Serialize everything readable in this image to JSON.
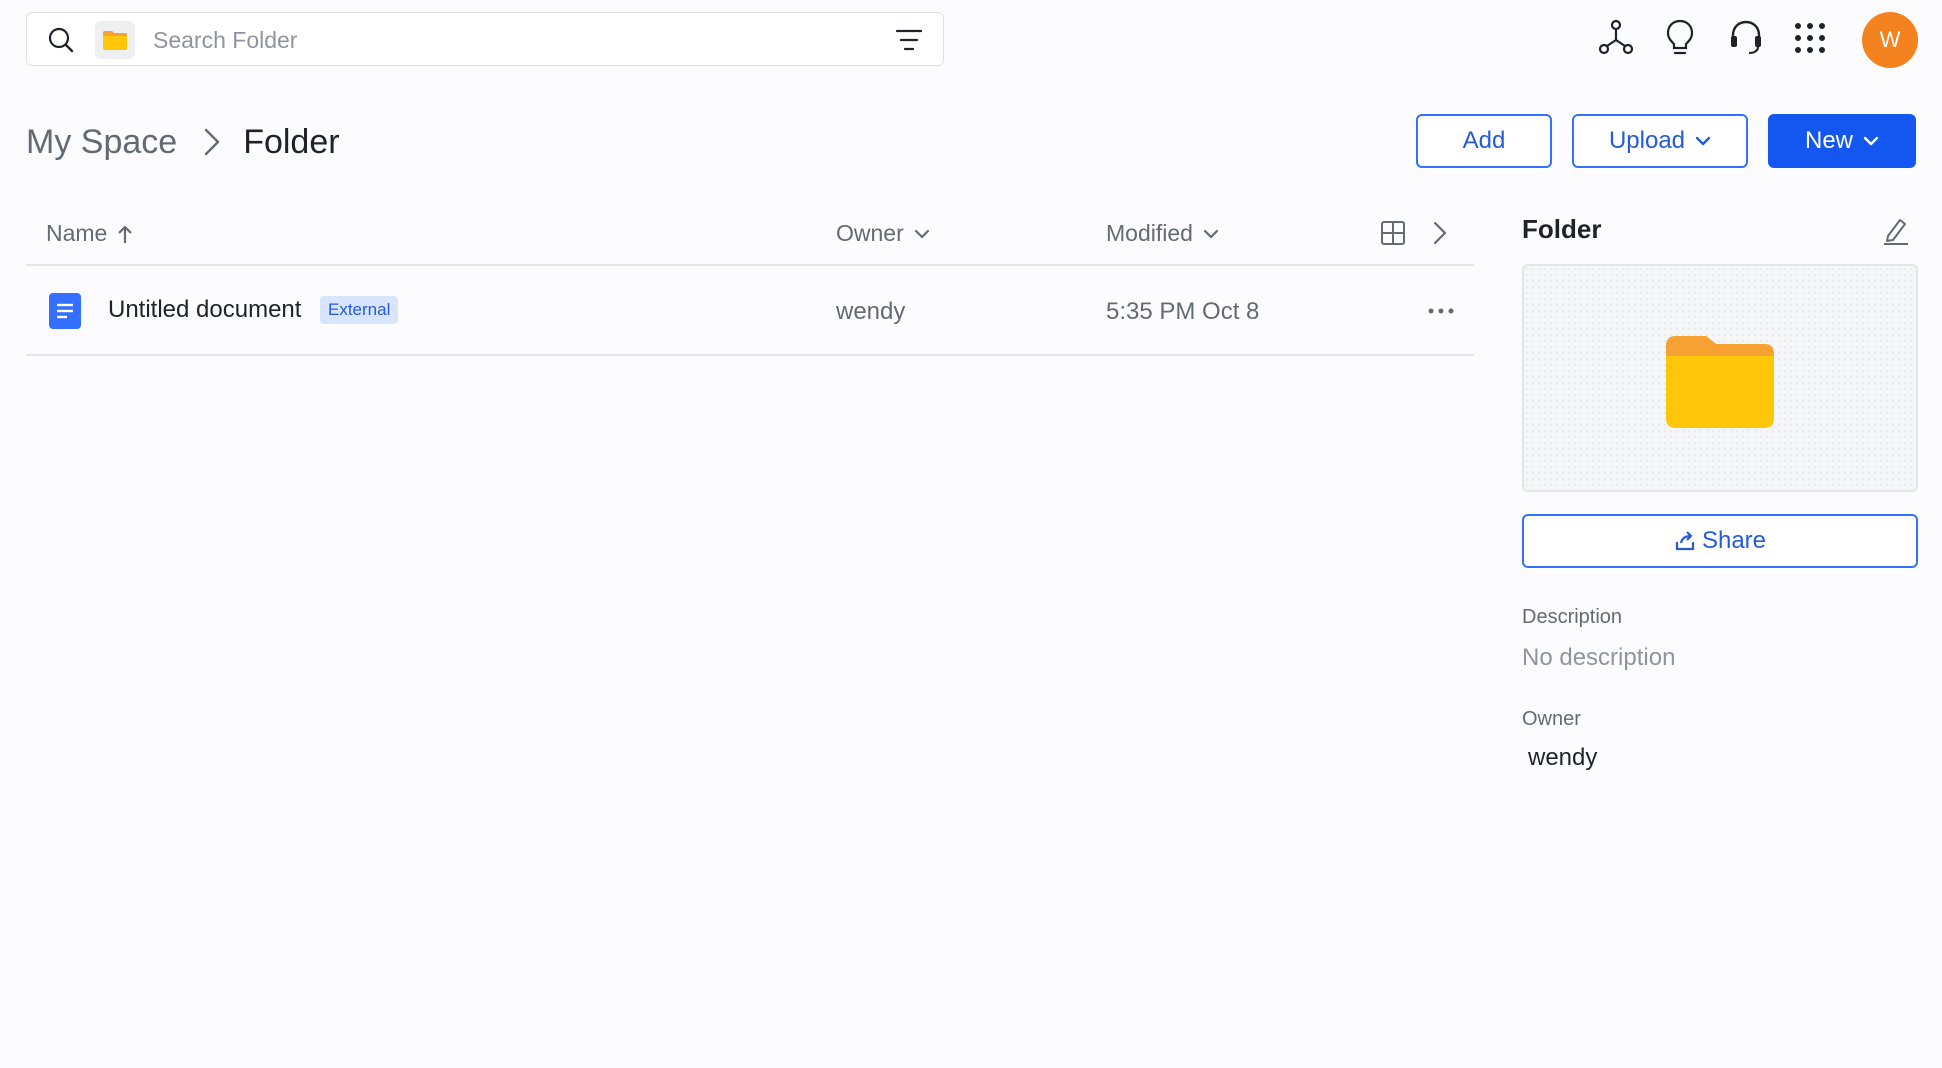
{
  "search": {
    "placeholder": "Search Folder",
    "scope_icon": "folder-icon"
  },
  "top_icons": [
    "share-tree-icon",
    "lightbulb-icon",
    "headset-icon",
    "app-grid-icon"
  ],
  "user": {
    "avatar_initial": "W",
    "avatar_color": "#f4831f"
  },
  "breadcrumb": {
    "root": "My Space",
    "current": "Folder"
  },
  "actions": {
    "add": "Add",
    "upload": "Upload",
    "new": "New"
  },
  "table": {
    "columns": {
      "name": "Name",
      "owner": "Owner",
      "modified": "Modified"
    },
    "sort": {
      "column": "Name",
      "direction": "ascending"
    },
    "rows": [
      {
        "name": "Untitled document",
        "badge": "External",
        "owner": "wendy",
        "modified": "5:35 PM Oct 8",
        "icon": "doc-icon"
      }
    ]
  },
  "details": {
    "title": "Folder",
    "share_label": "Share",
    "description_label": "Description",
    "description_value": "No description",
    "owner_label": "Owner",
    "owner_value": "wendy"
  },
  "colors": {
    "accent": "#1456f0",
    "accent_outline": "#3370ff",
    "folder_yellow": "#ffc60a",
    "folder_tab": "#f7a133",
    "doc_blue": "#3370ff"
  }
}
